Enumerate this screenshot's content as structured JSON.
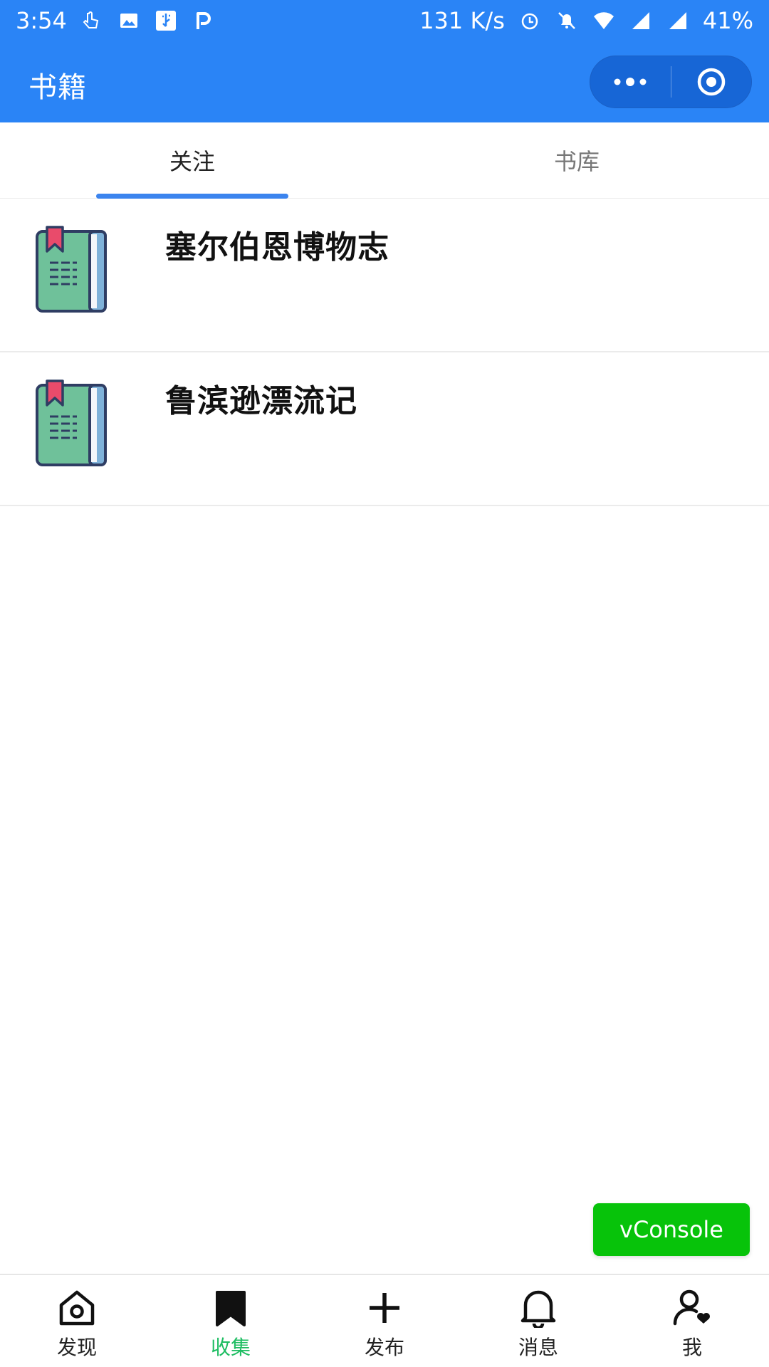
{
  "status_bar": {
    "time": "3:54",
    "network_speed": "131 K/s",
    "battery": "41%",
    "icons_left": [
      "touch-icon",
      "image-icon",
      "usb-icon",
      "p-icon"
    ],
    "icons_right": [
      "alarm-icon",
      "mute-icon",
      "wifi-icon",
      "signal-icon",
      "signal-icon"
    ]
  },
  "titlebar": {
    "title": "书籍",
    "more_icon": "more-dots-icon",
    "close_icon": "target-circle-icon"
  },
  "tabs": [
    {
      "label": "关注",
      "active": true
    },
    {
      "label": "书库",
      "active": false
    }
  ],
  "books": [
    {
      "title": "塞尔伯恩博物志",
      "icon": "book-icon"
    },
    {
      "title": "鲁滨逊漂流记",
      "icon": "book-icon"
    }
  ],
  "vconsole": {
    "label": "vConsole"
  },
  "bottom_nav": [
    {
      "label": "发现",
      "icon": "home-icon",
      "active": false
    },
    {
      "label": "收集",
      "icon": "bookmark-icon",
      "active": true
    },
    {
      "label": "发布",
      "icon": "plus-icon",
      "active": false
    },
    {
      "label": "消息",
      "icon": "bell-icon",
      "active": false
    },
    {
      "label": "我",
      "icon": "user-heart-icon",
      "active": false
    }
  ],
  "colors": {
    "primary_blue": "#2a84f6",
    "tab_indicator": "#3b84ee",
    "active_green": "#1ebd62",
    "vconsole_green": "#07c30a"
  }
}
